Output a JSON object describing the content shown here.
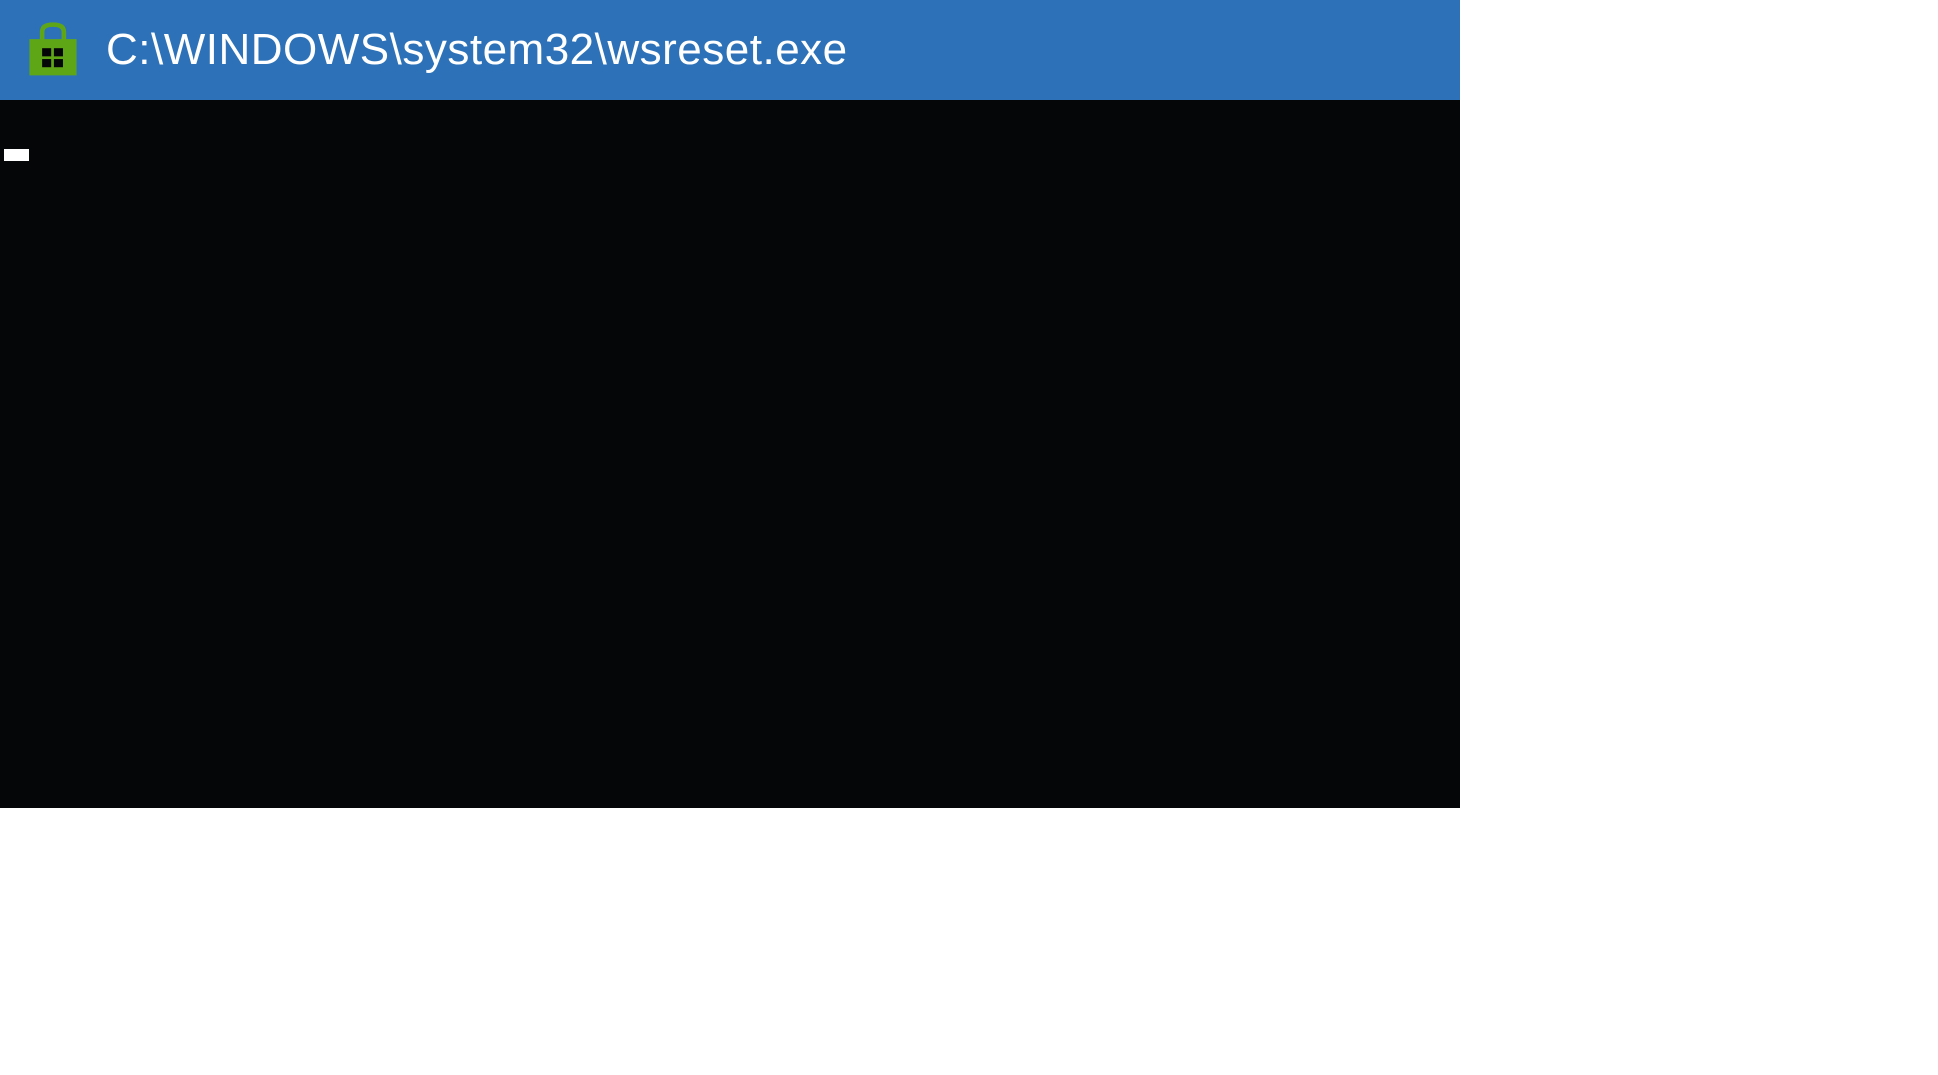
{
  "window": {
    "title": "C:\\WINDOWS\\system32\\wsreset.exe",
    "icon_name": "windows-store-icon"
  },
  "terminal": {
    "content": ""
  },
  "colors": {
    "title_bar_bg": "#2d72b8",
    "title_text": "#ffffff",
    "terminal_bg": "#050607",
    "cursor": "#ffffff",
    "icon_fill": "#5fa617"
  }
}
